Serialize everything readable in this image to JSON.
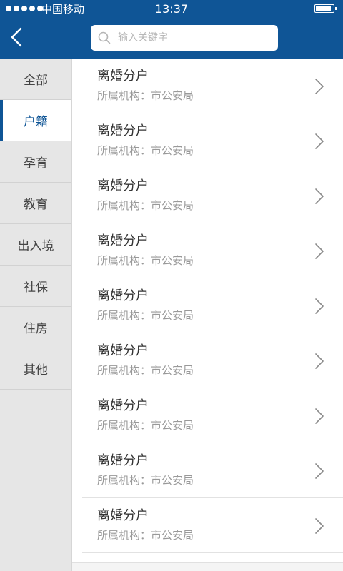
{
  "status_bar": {
    "carrier": "中国移动",
    "time": "13:37"
  },
  "search": {
    "placeholder": "输入关键字"
  },
  "icons": {
    "back": "chevron-left-icon",
    "search": "search-icon",
    "row_arrow": "chevron-right-icon",
    "signal": "signal-icon",
    "battery": "battery-icon"
  },
  "colors": {
    "primary": "#0f5596",
    "sidebar_bg": "#e6e6e6"
  },
  "sidebar": {
    "items": [
      {
        "label": "全部"
      },
      {
        "label": "户籍",
        "active": true
      },
      {
        "label": "孕育"
      },
      {
        "label": "教育"
      },
      {
        "label": "出入境"
      },
      {
        "label": "社保"
      },
      {
        "label": "住房"
      },
      {
        "label": "其他"
      }
    ]
  },
  "list": {
    "items": [
      {
        "title": "离婚分户",
        "subtitle": "所属机构：市公安局"
      },
      {
        "title": "离婚分户",
        "subtitle": "所属机构：市公安局"
      },
      {
        "title": "离婚分户",
        "subtitle": "所属机构：市公安局"
      },
      {
        "title": "离婚分户",
        "subtitle": "所属机构：市公安局"
      },
      {
        "title": "离婚分户",
        "subtitle": "所属机构：市公安局"
      },
      {
        "title": "离婚分户",
        "subtitle": "所属机构：市公安局"
      },
      {
        "title": "离婚分户",
        "subtitle": "所属机构：市公安局"
      },
      {
        "title": "离婚分户",
        "subtitle": "所属机构：市公安局"
      },
      {
        "title": "离婚分户",
        "subtitle": "所属机构：市公安局"
      }
    ]
  }
}
